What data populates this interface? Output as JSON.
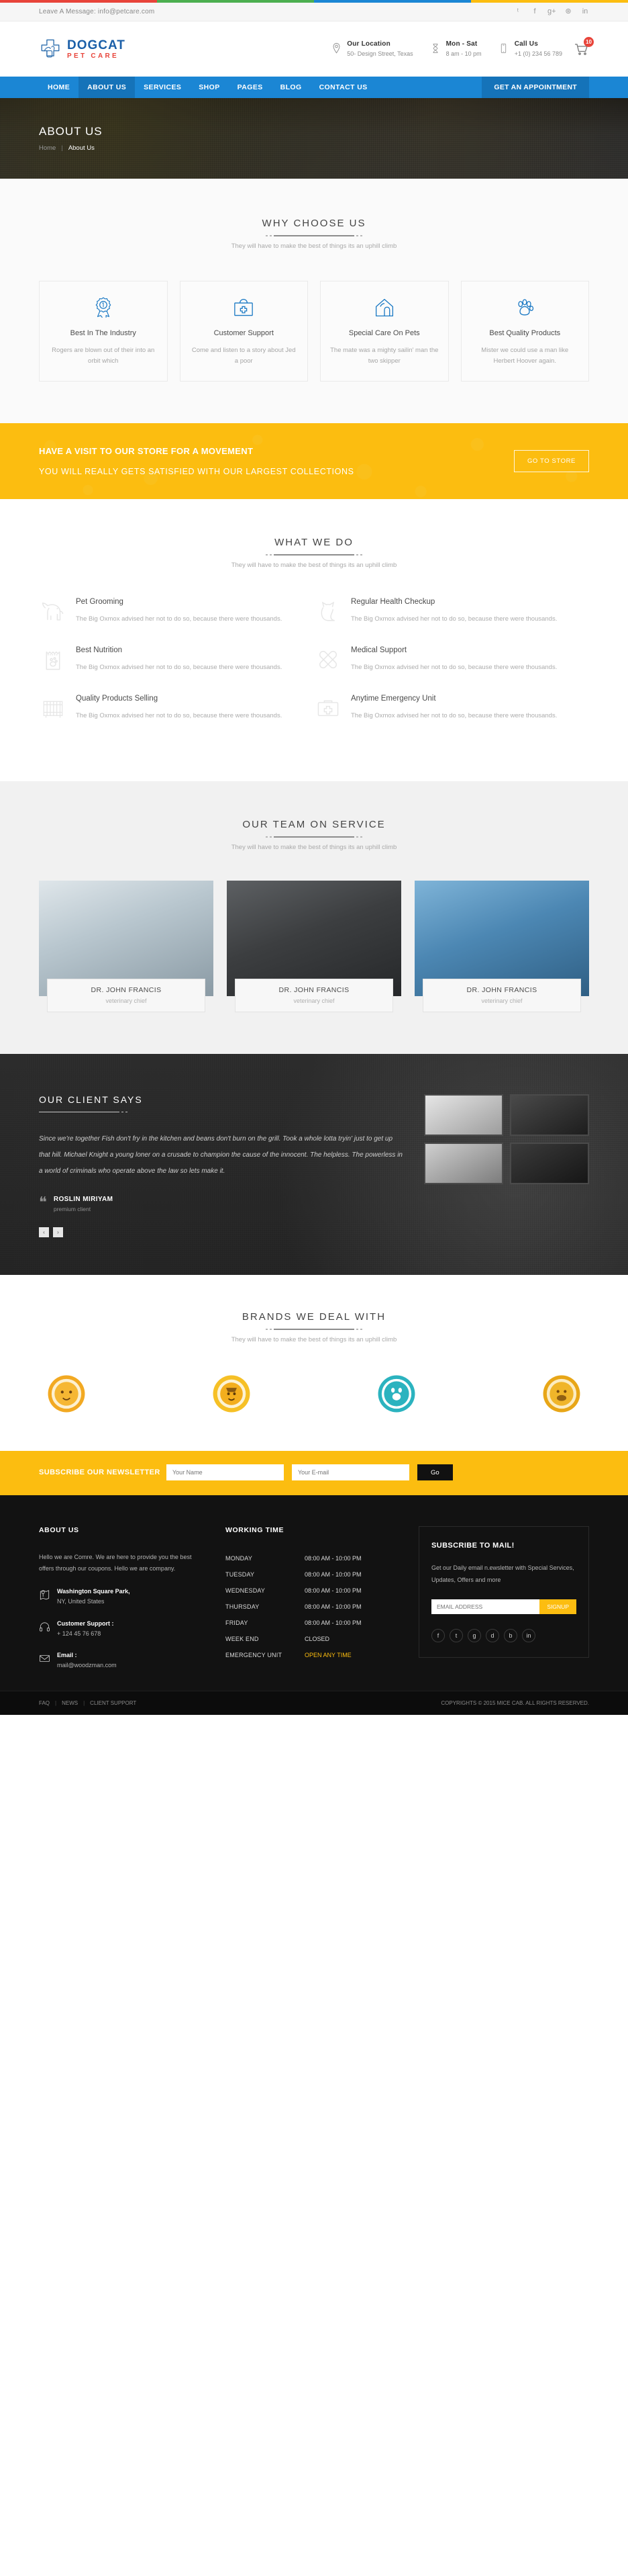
{
  "stripe_colors": [
    "#e8443a",
    "#4caf50",
    "#1b86d4",
    "#fcbd10"
  ],
  "topbar": {
    "message": "Leave A Message: info@petcare.com",
    "social": [
      {
        "name": "twitter-icon",
        "glyph": "ᵗ"
      },
      {
        "name": "facebook-icon",
        "glyph": "f"
      },
      {
        "name": "google-plus-icon",
        "glyph": "g+"
      },
      {
        "name": "dribbble-icon",
        "glyph": "⊛"
      },
      {
        "name": "linkedin-icon",
        "glyph": "in"
      }
    ]
  },
  "header": {
    "logo_main": "DOGCAT",
    "logo_sub": "PET CARE",
    "info": [
      {
        "icon": "location-pin-icon",
        "title": "Our Location",
        "sub": "50- Design Street, Texas"
      },
      {
        "icon": "hourglass-icon",
        "title": "Mon - Sat",
        "sub": "8 am - 10 pm"
      },
      {
        "icon": "mobile-phone-icon",
        "title": "Call Us",
        "sub": "+1 (0) 234 56 789"
      }
    ],
    "cart_count": "10"
  },
  "nav": {
    "items": [
      {
        "label": "HOME",
        "active": false
      },
      {
        "label": "ABOUT US",
        "active": true
      },
      {
        "label": "SERVICES",
        "active": false
      },
      {
        "label": "SHOP",
        "active": false
      },
      {
        "label": "PAGES",
        "active": false
      },
      {
        "label": "BLOG",
        "active": false
      },
      {
        "label": "CONTACT US",
        "active": false
      }
    ],
    "cta": "GET AN APPOINTMENT"
  },
  "banner": {
    "title": "ABOUT US",
    "crumb_home": "Home",
    "crumb_sep": "|",
    "crumb_current": "About Us"
  },
  "why_choose": {
    "title": "WHY CHOOSE US",
    "subtitle": "They will have to make the best of things its an uphill climb",
    "cards": [
      {
        "icon": "award-ribbon-icon",
        "title": "Best In The Industry",
        "text": "Rogers are blown out of their into an orbit which"
      },
      {
        "icon": "first-aid-kit-icon",
        "title": "Customer Support",
        "text": "Come and listen to a story about Jed a poor"
      },
      {
        "icon": "pet-house-icon",
        "title": "Special Care On Pets",
        "text": "The mate was a mighty sailin' man the two skipper"
      },
      {
        "icon": "paw-print-icon",
        "title": "Best Quality Products",
        "text": "Mister we could use a man like Herbert Hoover again."
      }
    ]
  },
  "cta_banner": {
    "heading": "HAVE A VISIT TO OUR STORE FOR A MOVEMENT",
    "sub": "YOU WILL REALLY GETS SATISFIED WITH OUR LARGEST COLLECTIONS",
    "button": "GO TO STORE"
  },
  "what_we_do": {
    "title": "WHAT WE DO",
    "subtitle": "They will have to make the best of things its an uphill climb",
    "items": [
      {
        "icon": "dog-icon",
        "title": "Pet Grooming",
        "text": "The Big Oxmox advised her not to do so, because there were thousands."
      },
      {
        "icon": "cat-icon",
        "title": "Regular Health Checkup",
        "text": "The Big Oxmox advised her not to do so, because there were thousands."
      },
      {
        "icon": "food-bag-icon",
        "title": "Best Nutrition",
        "text": "The Big Oxmox advised her not to do so, because there were thousands."
      },
      {
        "icon": "bandage-cross-icon",
        "title": "Medical Support",
        "text": "The Big Oxmox advised her not to do so, because there were thousands."
      },
      {
        "icon": "pet-cage-icon",
        "title": "Quality Products Selling",
        "text": "The Big Oxmox advised her not to do so, because there were thousands."
      },
      {
        "icon": "emergency-kit-icon",
        "title": "Anytime Emergency Unit",
        "text": "The Big Oxmox advised her not to do so, because there were thousands."
      }
    ]
  },
  "team": {
    "title": "OUR TEAM ON SERVICE",
    "subtitle": "They will have to make the best of things its an uphill climb",
    "members": [
      {
        "name": "DR. JOHN FRANCIS",
        "role": "veterinary chief"
      },
      {
        "name": "DR. JOHN FRANCIS",
        "role": "veterinary chief"
      },
      {
        "name": "DR. JOHN FRANCIS",
        "role": "veterinary chief"
      }
    ]
  },
  "testimonial": {
    "title": "OUR CLIENT SAYS",
    "quote": "Since we're together Fish don't fry in the kitchen and beans don't burn on the grill. Took a whole lotta tryin' just to get up that hill. Michael Knight a young loner on a crusade to champion the cause of the innocent. The helpless. The powerless in a world of criminals who operate above the law so lets make it.",
    "author_name": "ROSLIN MIRIYAM",
    "author_role": "premium client",
    "prev_label": "‹",
    "next_label": "›"
  },
  "brands": {
    "title": "BRANDS WE DEAL WITH",
    "subtitle": "They will have to make the best of things its an uphill climb",
    "logos": [
      {
        "name": "brand-logo-lion-badge"
      },
      {
        "name": "brand-logo-cat-badge"
      },
      {
        "name": "brand-logo-teal-seal"
      },
      {
        "name": "brand-logo-gold-medal"
      }
    ]
  },
  "newsletter": {
    "title": "SUBSCRIBE OUR NEWSLETTER",
    "name_placeholder": "Your Name",
    "email_placeholder": "Your E-mail",
    "button": "Go"
  },
  "footer": {
    "about": {
      "heading": "ABOUT US",
      "text": "Hello we are Comre. We are here to provide you the best offers through our coupons. Hello we are company.",
      "contacts": [
        {
          "icon": "map-marker-icon",
          "label": "Washington Square Park,",
          "value": "NY, United States"
        },
        {
          "icon": "headset-icon",
          "label": "Customer Support :",
          "value": "+ 124 45 76 678"
        },
        {
          "icon": "envelope-icon",
          "label": "Email :",
          "value": "mail@woodzman.com"
        }
      ]
    },
    "working_time": {
      "heading": "WORKING TIME",
      "rows": [
        {
          "day": "MONDAY",
          "hours": "08:00 AM - 10:00 PM",
          "highlight": false
        },
        {
          "day": "TUESDAY",
          "hours": "08:00 AM - 10:00 PM",
          "highlight": false
        },
        {
          "day": "WEDNESDAY",
          "hours": "08:00 AM - 10:00 PM",
          "highlight": false
        },
        {
          "day": "THURSDAY",
          "hours": "08:00 AM - 10:00 PM",
          "highlight": false
        },
        {
          "day": "FRIDAY",
          "hours": "08:00 AM - 10:00 PM",
          "highlight": false
        },
        {
          "day": "WEEK END",
          "hours": "CLOSED",
          "highlight": false
        },
        {
          "day": "EMERGENCY UNIT",
          "hours": "OPEN ANY TIME",
          "highlight": true
        }
      ]
    },
    "subscribe": {
      "heading": "SUBSCRIBE TO MAIL!",
      "text": "Get our Daily email n.ewsletter with Special Services, Updates, Offers and more",
      "placeholder": "EMAIL ADDRESS",
      "button": "SIGNUP",
      "social": [
        {
          "name": "facebook-icon",
          "glyph": "f"
        },
        {
          "name": "twitter-icon",
          "glyph": "t"
        },
        {
          "name": "google-plus-icon",
          "glyph": "g"
        },
        {
          "name": "dribbble-icon",
          "glyph": "d"
        },
        {
          "name": "behance-icon",
          "glyph": "b"
        },
        {
          "name": "linkedin-icon",
          "glyph": "in"
        }
      ]
    }
  },
  "copyright": {
    "links": [
      "FAQ",
      "NEWS",
      "CLIENT SUPPORT"
    ],
    "text": "COPYRIGHTS © 2015 MICE CAB. ALL RIGHTS RESERVED."
  }
}
